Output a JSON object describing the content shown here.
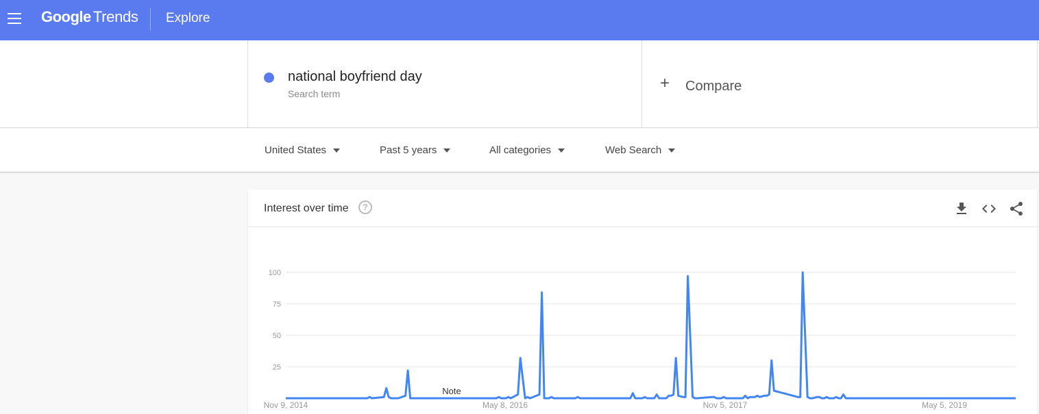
{
  "header": {
    "brand_google": "Google",
    "brand_trends": "Trends",
    "section": "Explore"
  },
  "search": {
    "term": "national boyfriend day",
    "term_type": "Search term",
    "compare_label": "Compare",
    "term_color": "#5a7bef"
  },
  "filters": [
    {
      "label": "United States"
    },
    {
      "label": "Past 5 years"
    },
    {
      "label": "All categories"
    },
    {
      "label": "Web Search"
    }
  ],
  "card": {
    "title": "Interest over time",
    "help": "?"
  },
  "chart_data": {
    "type": "line",
    "title": "Interest over time",
    "ylim": [
      0,
      100
    ],
    "yticks": [
      25,
      50,
      75,
      100
    ],
    "grid": true,
    "line_color": "#4285f4",
    "xtick_labels": [
      "Nov 9, 2014",
      "May 8, 2016",
      "Nov 5, 2017",
      "May 5, 2019"
    ],
    "note_label": "Note",
    "series": [
      {
        "x_week_index": [
          0,
          34,
          35,
          36,
          41,
          42,
          43,
          44,
          46,
          47,
          50,
          51,
          52,
          88,
          89,
          90,
          92,
          93,
          94,
          96,
          97,
          98,
          100,
          101,
          102,
          106,
          107,
          108,
          110,
          111,
          112,
          121,
          122,
          123,
          144,
          145,
          146,
          149,
          150,
          151,
          154,
          155,
          156,
          159,
          160,
          161,
          162,
          163,
          164,
          166,
          167,
          168,
          170,
          171,
          172,
          178,
          179,
          180,
          182,
          183,
          184,
          191,
          192,
          193,
          194,
          196,
          197,
          198,
          200,
          201,
          202,
          203,
          204,
          214,
          215,
          216,
          218,
          219,
          220,
          222,
          223,
          224,
          225,
          226,
          227,
          229,
          230,
          231,
          232,
          233,
          234,
          236,
          237,
          238,
          240,
          241,
          242,
          271,
          272,
          273,
          276,
          277,
          278,
          282,
          283,
          284,
          285,
          286,
          287,
          288,
          289,
          290,
          291,
          294,
          295,
          296,
          298,
          299,
          300,
          305
        ],
        "y": [
          0,
          0,
          1,
          0,
          1,
          8,
          1,
          0,
          0,
          0,
          2,
          22,
          0,
          0,
          1,
          0,
          0,
          1,
          0,
          2,
          3,
          32,
          0,
          1,
          0,
          3,
          84,
          0,
          0,
          1,
          0,
          0,
          1,
          0,
          0,
          4,
          0,
          0,
          1,
          0,
          0,
          3,
          0,
          0,
          2,
          2,
          3,
          32,
          2,
          1,
          1,
          97,
          1,
          0,
          0,
          1,
          1,
          0,
          0,
          1,
          0,
          0,
          2,
          0,
          1,
          1,
          2,
          1,
          2,
          2,
          3,
          30,
          6,
          1,
          1,
          100,
          1,
          0,
          0,
          1,
          1,
          0,
          0,
          1,
          0,
          0,
          1,
          0,
          0,
          3,
          0,
          0,
          0,
          0,
          0,
          0,
          0,
          0,
          0,
          0,
          0,
          0,
          0,
          0,
          0,
          0,
          0,
          0,
          0,
          0,
          0,
          0,
          0,
          0,
          0,
          0,
          0,
          0,
          0,
          0
        ]
      }
    ]
  }
}
